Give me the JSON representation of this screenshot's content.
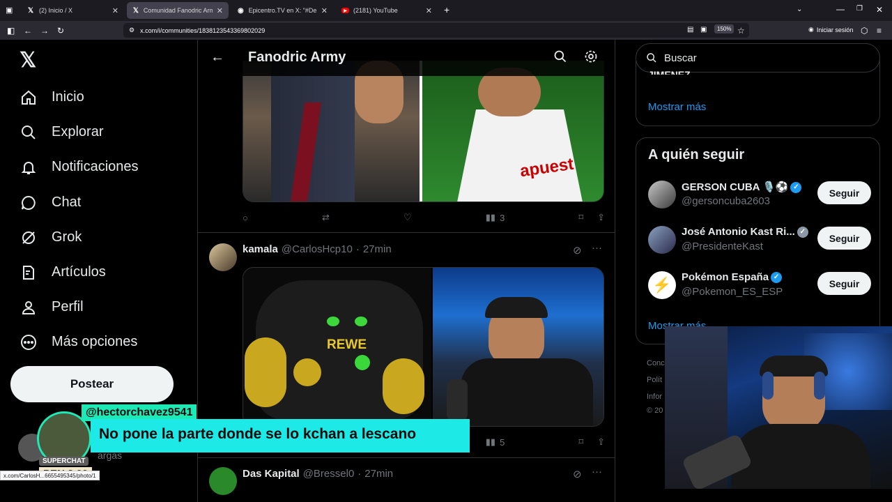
{
  "tabs": [
    {
      "label": "(2) Inicio / X",
      "icon": "x-logo-icon",
      "active": false
    },
    {
      "label": "Comunidad Fanodric Army / X",
      "icon": "x-logo-icon",
      "active": true
    },
    {
      "label": "Epicentro.TV en X: \"#Debat",
      "icon": "circle-icon",
      "active": false
    },
    {
      "label": "(2181) YouTube",
      "icon": "youtube-icon",
      "active": false
    }
  ],
  "browser": {
    "url": "x.com/i/communities/1838123543369802029",
    "zoom": "150%",
    "login_label": "Iniciar sesión",
    "status_url": "x.com/CarlosH...6655495345/photo/1"
  },
  "nav": {
    "items": [
      {
        "label": "Inicio",
        "icon": "home-icon"
      },
      {
        "label": "Explorar",
        "icon": "search-icon"
      },
      {
        "label": "Notificaciones",
        "icon": "bell-icon"
      },
      {
        "label": "Chat",
        "icon": "chat-icon"
      },
      {
        "label": "Grok",
        "icon": "grok-icon"
      },
      {
        "label": "Artículos",
        "icon": "articles-icon"
      },
      {
        "label": "Perfil",
        "icon": "user-icon"
      },
      {
        "label": "Más opciones",
        "icon": "more-icon"
      }
    ],
    "post_label": "Postear",
    "profile_name_partial": "argas"
  },
  "main": {
    "title": "Fanodric Army",
    "tweet1": {
      "views": "3"
    },
    "tweet2": {
      "name": "kamala",
      "handle": "@CarlosHcp10",
      "time": "27min",
      "views": "5",
      "jersey_text": "REWE"
    },
    "tweet3": {
      "name": "Das Kapital",
      "handle": "@Bressel0",
      "time": "27min"
    }
  },
  "right": {
    "search_placeholder": "Buscar",
    "trend_partial": "JIMENEZ",
    "show_more": "Mostrar más",
    "who_to_follow_title": "A quién seguir",
    "follow": [
      {
        "name": "GERSON CUBA 🎙️⚽",
        "handle": "@gersoncuba2603",
        "button": "Seguir"
      },
      {
        "name": "José Antonio Kast Ri...",
        "handle": "@PresidenteKast",
        "button": "Seguir"
      },
      {
        "name": "Pokémon España",
        "handle": "@Pokemon_ES_ESP",
        "button": "Seguir"
      }
    ],
    "show_more_2": "Mostrar más",
    "footer": [
      "Conc",
      "Polít",
      "Infor",
      "© 20"
    ]
  },
  "overlay": {
    "superchat_user": "@hectorchavez9541",
    "superchat_message": "No pone la parte donde se lo kchan a lescano",
    "superchat_badge": "SUPERCHAT",
    "superchat_amount": "PEN 2.00"
  },
  "colors": {
    "accent": "#1d9bf0",
    "superchat": "#1de9e6",
    "background": "#000000"
  }
}
